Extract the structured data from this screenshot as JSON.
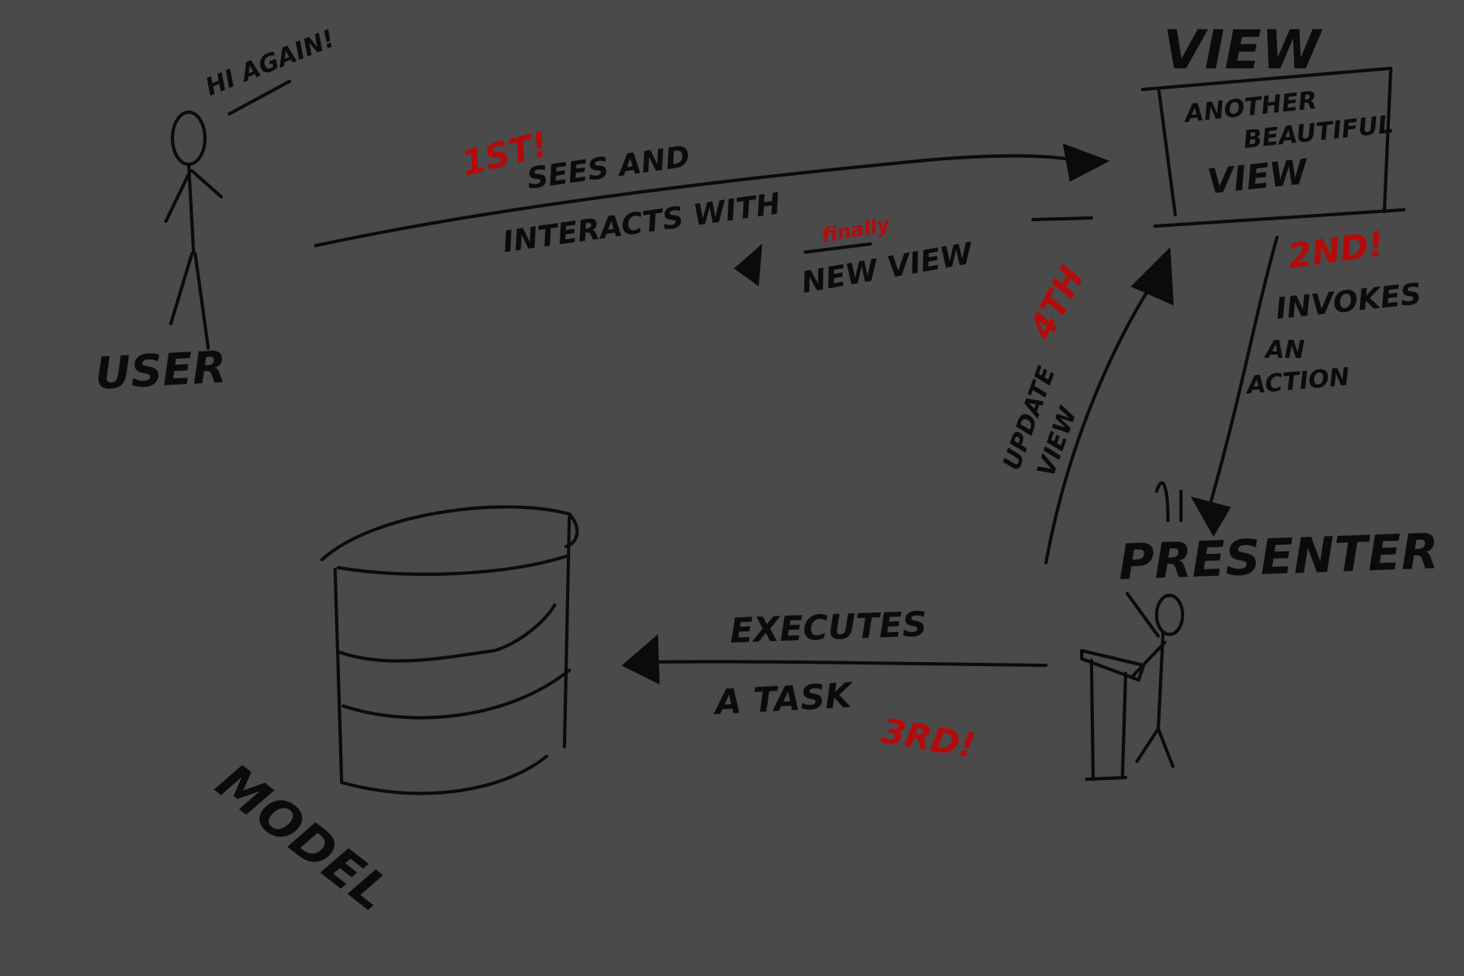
{
  "background": "#4a4a4a",
  "ink_color": "#0b0b0b",
  "accent_color": "#b30b0b",
  "labels": {
    "user": "USER",
    "hi_again": "HI AGAIN!",
    "view_title": "VIEW",
    "view_content": [
      "ANOTHER",
      "BEAUTIFUL",
      "VIEW"
    ],
    "presenter": "PRESENTER",
    "model": "MODEL",
    "sees_and": "SEES AND",
    "interacts_with": "INTERACTS WITH",
    "new_view": "NEW VIEW",
    "finally": "finally",
    "invokes": "INVOKES",
    "an": "AN",
    "action": "ACTION",
    "update": "UPDATE",
    "view_word": "VIEW",
    "executes": "EXECUTES",
    "a_task": "A TASK"
  },
  "steps": {
    "first": "1ST!",
    "second": "2ND!",
    "third": "3RD!",
    "fourth": "4TH"
  },
  "icons": [
    "stick-figure-user-icon",
    "presenter-podium-icon",
    "database-cylinder-icon"
  ]
}
